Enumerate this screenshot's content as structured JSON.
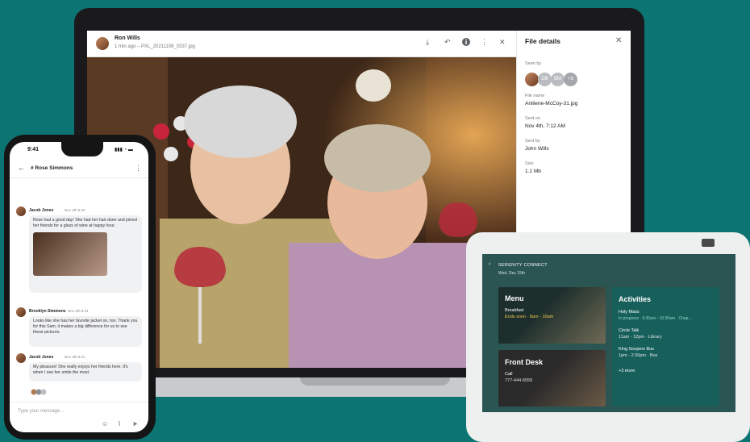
{
  "laptop": {
    "viewer": {
      "sender": "Ron Wills",
      "meta": "1 min ago – PXL_20211108_0337.jpg",
      "icons": [
        "download-icon",
        "reply-icon",
        "info-icon",
        "more-icon",
        "close-icon"
      ]
    },
    "file_details": {
      "title": "File details",
      "seen_by_label": "Seen by",
      "seen_by": [
        {
          "initials": "",
          "kind": "photo"
        },
        {
          "initials": "DB"
        },
        {
          "initials": "BM"
        },
        {
          "initials": "+3"
        }
      ],
      "file_name_label": "File name",
      "file_name": "Aniliene-McCoy-31.jpg",
      "sent_on_label": "Sent on",
      "sent_on": "Nov 4th, 7:12 AM",
      "sent_by_label": "Sent by",
      "sent_by": "John Wills",
      "size_label": "Size",
      "size": "1.1 Mb"
    }
  },
  "phone": {
    "status": {
      "time": "9:41",
      "icons": "▮▮▮ ◔ ▬"
    },
    "chat_title": "# Rose Simmons",
    "messages": [
      {
        "name": "Jacob Jones",
        "time": "Nov 4th 8:20",
        "text": "Rose had a good day! She had her hair done and joined her friends for a glass of wine at happy hour."
      },
      {
        "name": "Brooklyn Simmons",
        "time": "Nov 4th 8:24",
        "text": "Looks like she has her favorite jacket on, too. Thank you for this Sam, it makes a big difference for us to see these pictures."
      },
      {
        "name": "Jacob Jones",
        "time": "Nov 4th 8:31",
        "text": "My pleasure! She really enjoys her friends here. It's when I see her smile the most."
      }
    ],
    "composer_placeholder": "Type your message..."
  },
  "hub": {
    "title": "SERENITY CONNECT",
    "date": "Wed, Dec 15th",
    "menu": {
      "title": "Menu",
      "meal": "Breakfast",
      "status": "Ends soon · 8am - 10am"
    },
    "front_desk": {
      "title": "Front Desk",
      "call_label": "Call",
      "phone": "777-444-5555"
    },
    "activities": {
      "title": "Activities",
      "items": [
        {
          "name": "Holy Mass",
          "detail": "In progress · 9:30am - 10:30am · Chap..."
        },
        {
          "name": "Circle Talk",
          "detail": "11am - 12pm · Library"
        },
        {
          "name": "King Soopers Bus",
          "detail": "1pm - 2:30pm · Bus"
        }
      ],
      "more": "+3 more"
    }
  }
}
